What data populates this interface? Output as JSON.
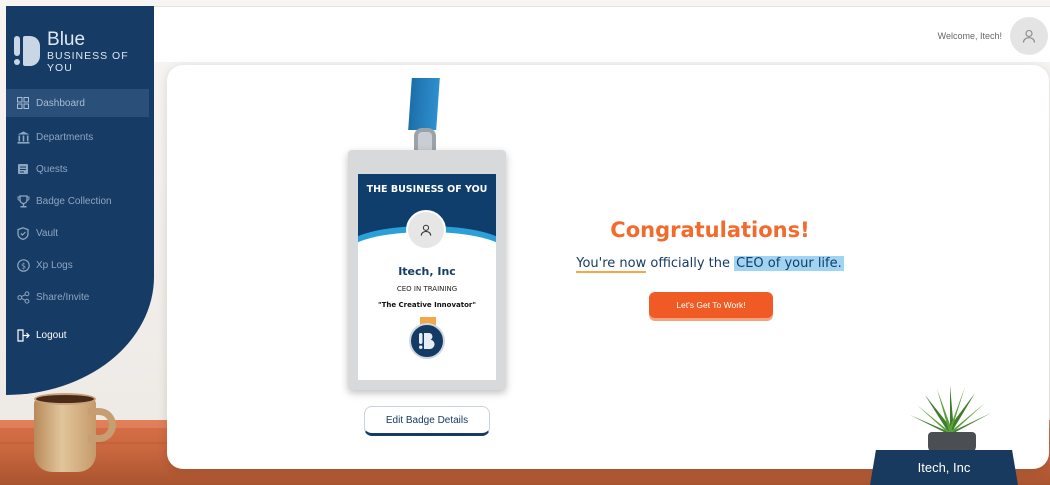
{
  "brand": {
    "title": "Blue",
    "subtitle": "BUSINESS OF YOU"
  },
  "sidebar": {
    "items": [
      {
        "label": "Dashboard",
        "icon": "grid-icon",
        "active": true
      },
      {
        "label": "Departments",
        "icon": "bank-icon"
      },
      {
        "label": "Quests",
        "icon": "scroll-icon"
      },
      {
        "label": "Badge Collection",
        "icon": "trophy-icon"
      },
      {
        "label": "Vault",
        "icon": "shield-icon"
      },
      {
        "label": "Xp Logs",
        "icon": "dollar-icon"
      },
      {
        "label": "Share/Invite",
        "icon": "share-icon"
      }
    ],
    "logout": {
      "label": "Logout",
      "icon": "logout-icon"
    }
  },
  "header": {
    "welcome": "Welcome, Itech!",
    "avatar_icon": "user-icon"
  },
  "badge": {
    "title": "THE BUSINESS OF YOU",
    "name": "Itech, Inc",
    "role": "CEO IN TRAINING",
    "motto": "\"The Creative Innovator\"",
    "edit_label": "Edit Badge Details"
  },
  "message": {
    "heading": "Congratulations!",
    "line_part1": "You're now",
    "line_part2": " officially the ",
    "line_part3": "CEO of your life.",
    "button_label": "Let's Get To Work!"
  },
  "nameplate": "Itech, Inc",
  "colors": {
    "sidebar": "#163b64",
    "accent": "#f05a24",
    "heading": "#f26a2c",
    "highlight": "#9fd4f2"
  }
}
